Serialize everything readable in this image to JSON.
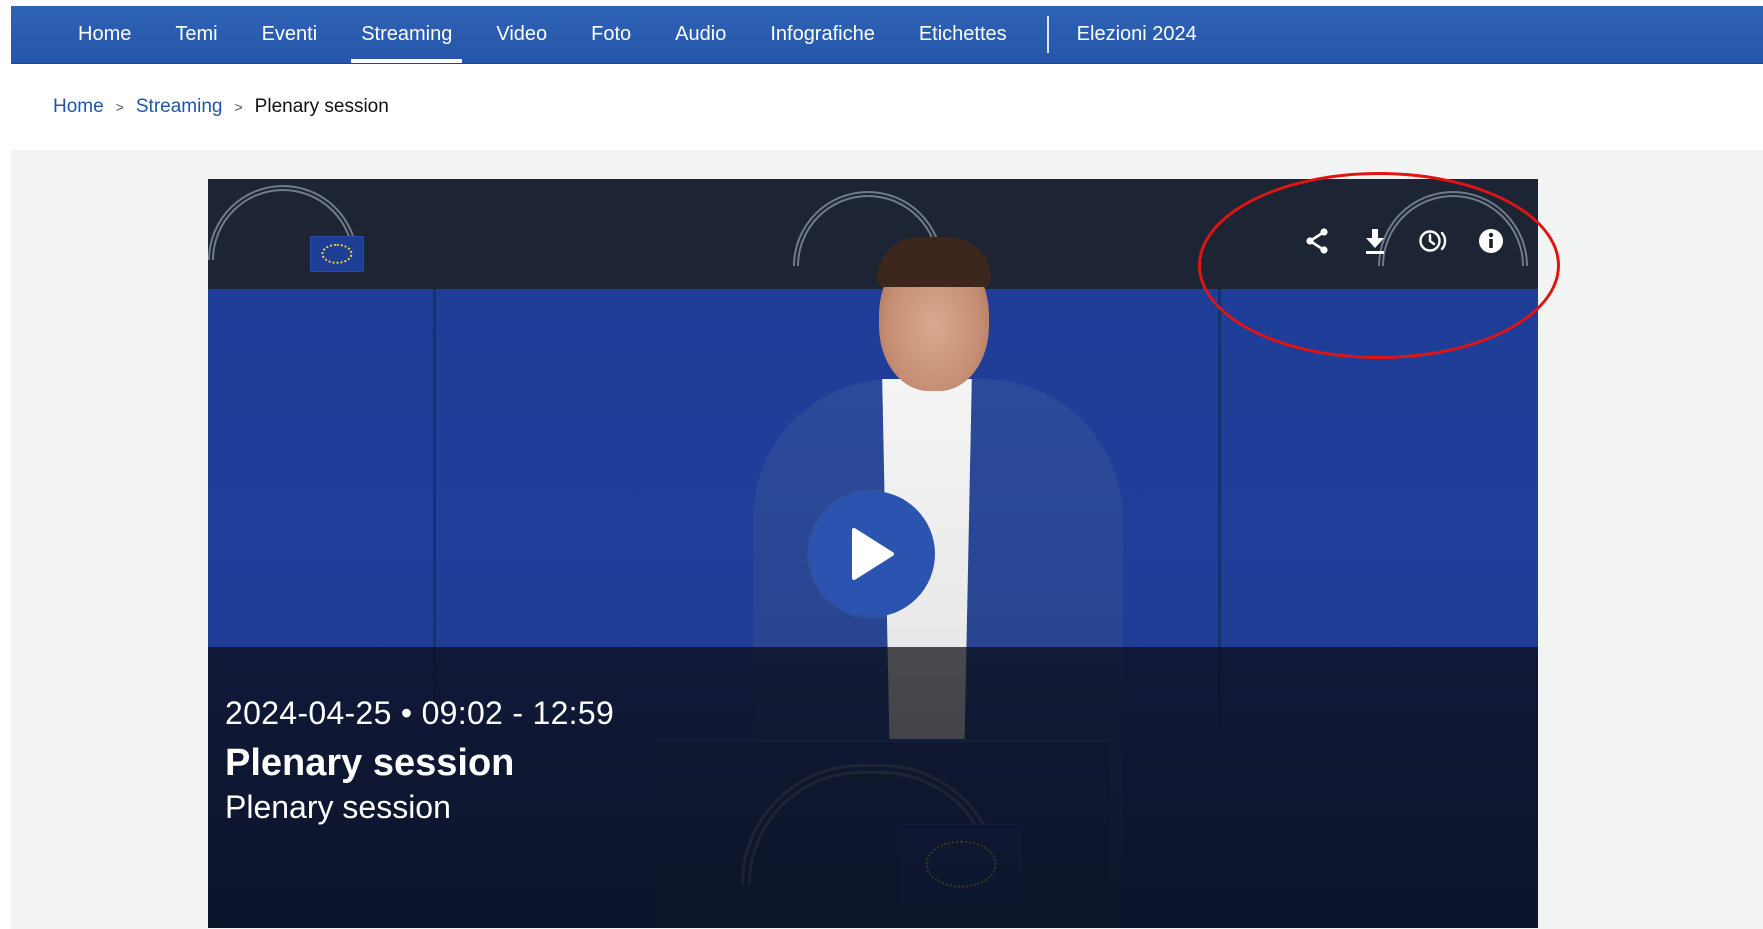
{
  "nav": {
    "items": [
      {
        "label": "Home",
        "active": false
      },
      {
        "label": "Temi",
        "active": false
      },
      {
        "label": "Eventi",
        "active": false
      },
      {
        "label": "Streaming",
        "active": true
      },
      {
        "label": "Video",
        "active": false
      },
      {
        "label": "Foto",
        "active": false
      },
      {
        "label": "Audio",
        "active": false
      },
      {
        "label": "Infografiche",
        "active": false
      },
      {
        "label": "Etichettes",
        "active": false
      }
    ],
    "extra_label": "Elezioni 2024",
    "background_color": "#2a5cb0"
  },
  "breadcrumb": {
    "items": [
      "Home",
      "Streaming"
    ],
    "separator": ">",
    "current": "Plenary session"
  },
  "video": {
    "datetime": "2024-04-25 • 09:02 - 12:59",
    "title": "Plenary session",
    "subtitle": "Plenary session",
    "controls": [
      {
        "name": "share-icon"
      },
      {
        "name": "download-icon"
      },
      {
        "name": "history-icon"
      },
      {
        "name": "info-icon"
      }
    ],
    "play_icon": "play-icon",
    "play_button_color": "#2a54b0"
  },
  "annotation": {
    "color": "#e01414",
    "shape": "ellipse"
  }
}
